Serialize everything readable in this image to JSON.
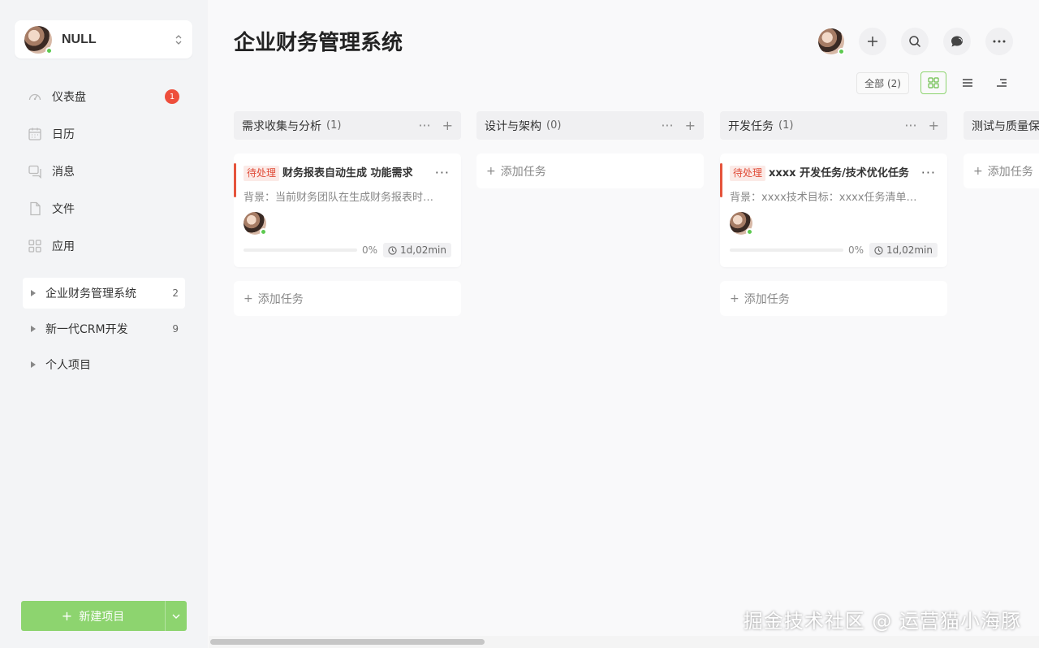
{
  "user": {
    "name": "NULL"
  },
  "nav": [
    {
      "label": "仪表盘",
      "icon": "dashboard-icon",
      "badge": "1"
    },
    {
      "label": "日历",
      "icon": "calendar-icon"
    },
    {
      "label": "消息",
      "icon": "message-icon"
    },
    {
      "label": "文件",
      "icon": "file-icon"
    },
    {
      "label": "应用",
      "icon": "apps-icon"
    }
  ],
  "projects": [
    {
      "name": "企业财务管理系统",
      "count": "2",
      "active": true
    },
    {
      "name": "新一代CRM开发",
      "count": "9"
    },
    {
      "name": "个人项目",
      "count": ""
    }
  ],
  "new_project": "新建项目",
  "page_title": "企业财务管理系统",
  "filter": "全部 (2)",
  "columns": [
    {
      "title": "需求收集与分析",
      "count": "(1)"
    },
    {
      "title": "设计与架构",
      "count": "(0)"
    },
    {
      "title": "开发任务",
      "count": "(1)"
    },
    {
      "title": "测试与质量保",
      "count": ""
    }
  ],
  "cards": [
    {
      "tag": "待处理",
      "title": "财务报表自动生成  功能需求",
      "desc": "背景：当前财务团队在生成财务报表时…",
      "progress": 0,
      "progress_label": "0%",
      "time": "1d,02min"
    },
    {
      "tag": "待处理",
      "title": "xxxx  开发任务/技术优化任务",
      "desc": "背景：xxxx技术目标：xxxx任务清单…",
      "progress": 0,
      "progress_label": "0%",
      "time": "1d,02min"
    }
  ],
  "add_task": "添加任务",
  "watermark": "掘金技术社区 @ 运营猫小海豚",
  "colors": {
    "accent": "#8dd46f",
    "tag_red": "#e04b37",
    "badge_red": "#ee4e3c"
  }
}
